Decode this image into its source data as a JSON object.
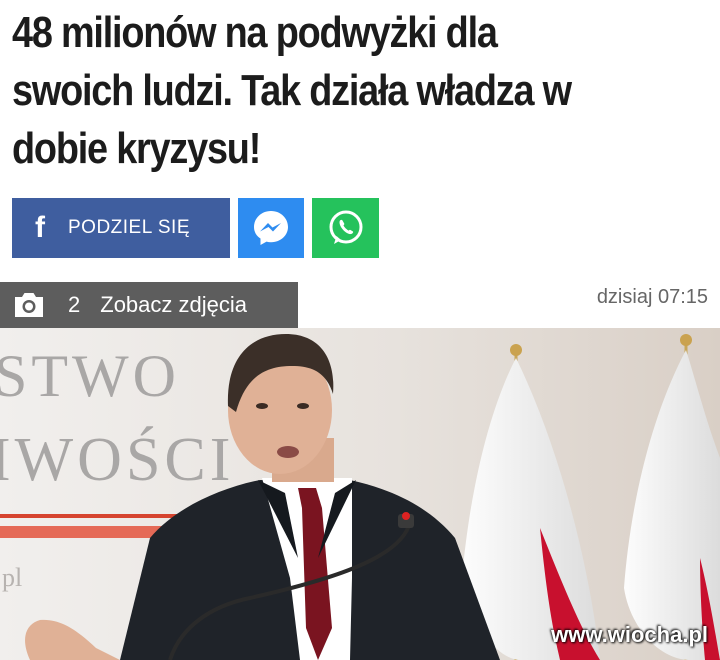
{
  "article": {
    "headline": "48 milionów na podwyżki dla swoich ludzi. Tak działa władza w dobie kryzysu!",
    "timestamp": "dzisiaj 07:15"
  },
  "share": {
    "facebook_label": "PODZIEL SIĘ",
    "facebook_icon": "facebook-f-icon",
    "messenger_icon": "messenger-icon",
    "whatsapp_icon": "whatsapp-icon",
    "facebook_color": "#3f5e9f",
    "messenger_color": "#2e8cf0",
    "whatsapp_color": "#25c25c"
  },
  "gallery": {
    "icon": "camera-icon",
    "count": "2",
    "label": "Zobacz zdjęcia"
  },
  "photo": {
    "wall_text_line1": "STWO",
    "wall_text_line2": "IWOŚCI",
    "wall_text_line3": "pl",
    "watermark": "www.wiocha.pl"
  }
}
